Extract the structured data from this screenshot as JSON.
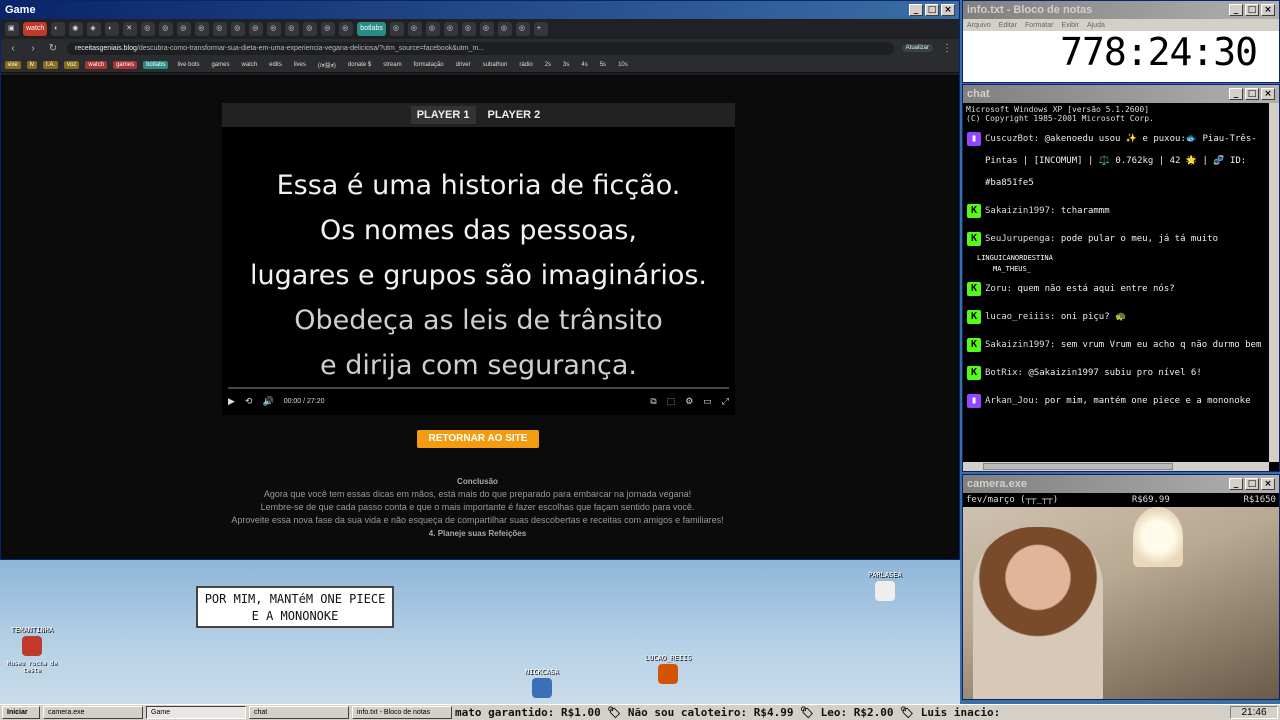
{
  "browser": {
    "title": "Game",
    "tabs": [
      "watch",
      "botlabs"
    ],
    "url_domain": "receitasgeniais.blog",
    "url_path": "/descubra-como-transformar-sua-dieta-em-uma-experiencia-vegana-deliciosa/?utm_source=facebook&utm_m...",
    "update_label": "Atualizar",
    "bookmarks": [
      "exe",
      "lv",
      "I.A.",
      "voz",
      "watch",
      "games",
      "botlabs",
      "live bots",
      "games",
      "watch",
      "edits",
      "lives",
      "(/ತ益ತ)",
      "donate $",
      "stream",
      "formatação",
      "driver",
      "subathon",
      "rádio",
      "2s",
      "3s",
      "4s",
      "5s",
      "10s"
    ]
  },
  "player": {
    "tab1": "PLAYER 1",
    "tab2": "PLAYER 2",
    "lines": [
      "Essa é uma historia de ficção.",
      "Os nomes das pessoas,",
      "lugares e grupos são imaginários.",
      "Obedeça as leis de trânsito",
      "e dirija com segurança."
    ],
    "time": "00:00 / 27:20",
    "progress": 0
  },
  "page": {
    "return_button": "RETORNAR AO SITE",
    "heading": "Conclusão",
    "paragraphs": [
      "Agora que você tem essas dicas em mãos, está mais do que preparado para embarcar na jornada vegana!",
      "Lembre-se de que cada passo conta e que o mais importante é fazer escolhas que façam sentido para você.",
      "Aproveite essa nova fase da sua vida e não esqueça de compartilhar suas descobertas e receitas com amigos e familiares!"
    ],
    "subheading": "4. Planeje suas Refeições"
  },
  "notepad": {
    "title": "info.txt - Bloco de notas",
    "menu": [
      "Arquivo",
      "Editar",
      "Formatar",
      "Exibir",
      "Ajuda"
    ],
    "timer": "778:24:30"
  },
  "chat": {
    "title": "chat",
    "header_lines": [
      "Microsoft Windows XP [versão 5.1.2600]",
      "(C) Copyright 1985-2001 Microsoft Corp."
    ],
    "messages": [
      {
        "platform": "twitch",
        "user": "CuscuzBot:",
        "text": "@akenoedu usou ✨ e puxou:🐟 Piau-Três-Pintas | [INCOMUM] | ⚖️ 0.762kg | 42 🌟 | 🧬 ID: #ba851fe5"
      },
      {
        "platform": "kick",
        "user": "Sakaizin1997:",
        "text": "tcharammm"
      },
      {
        "platform": "kick",
        "user": "SeuJurupenga:",
        "text": "pode pular o meu, já tá muito"
      },
      {
        "platform": "kick",
        "user": "Zoru:",
        "text": "quem não está aqui entre nós?"
      },
      {
        "platform": "kick",
        "user": "lucao_reiiis:",
        "text": "oni piçu? 🐢"
      },
      {
        "platform": "kick",
        "user": "Sakaizin1997:",
        "text": "sem vrum Vrum eu acho q não durmo bem"
      },
      {
        "platform": "kick",
        "user": "BotRix:",
        "text": "@Sakaizin1997 subiu pro nível 6!"
      },
      {
        "platform": "twitch",
        "user": "Arkan_Jou:",
        "text": "por mim, mantém one piece e a mononoke"
      }
    ],
    "overlay_names": [
      "LINGUICANORDESTINA",
      "MA_THEUS_"
    ]
  },
  "camera": {
    "title": "camera.exe",
    "label": "fev/março (┬┬_┬┬)",
    "price1": "R$69.99",
    "price2": "R$1650"
  },
  "game": {
    "speech": "POR MIM, MANTéM ONE PIECE E A MONONOKE",
    "avatars": [
      "TEMANTINHA",
      "PARLASEA",
      "NICKCASA",
      "LUCAO_REIIS"
    ],
    "footer_note": "Museu rocha de teste"
  },
  "taskbar": {
    "start": "Iniciar",
    "items": [
      "camera.exe",
      "Game",
      "chat",
      "info.txt - Bloco de notas"
    ],
    "ticker": "mato garantido: R$1.00 🏷 Não sou caloteiro: R$4.99 🏷 Leo: R$2.00 🏷 Luis inacio:",
    "clock": "21:46"
  }
}
